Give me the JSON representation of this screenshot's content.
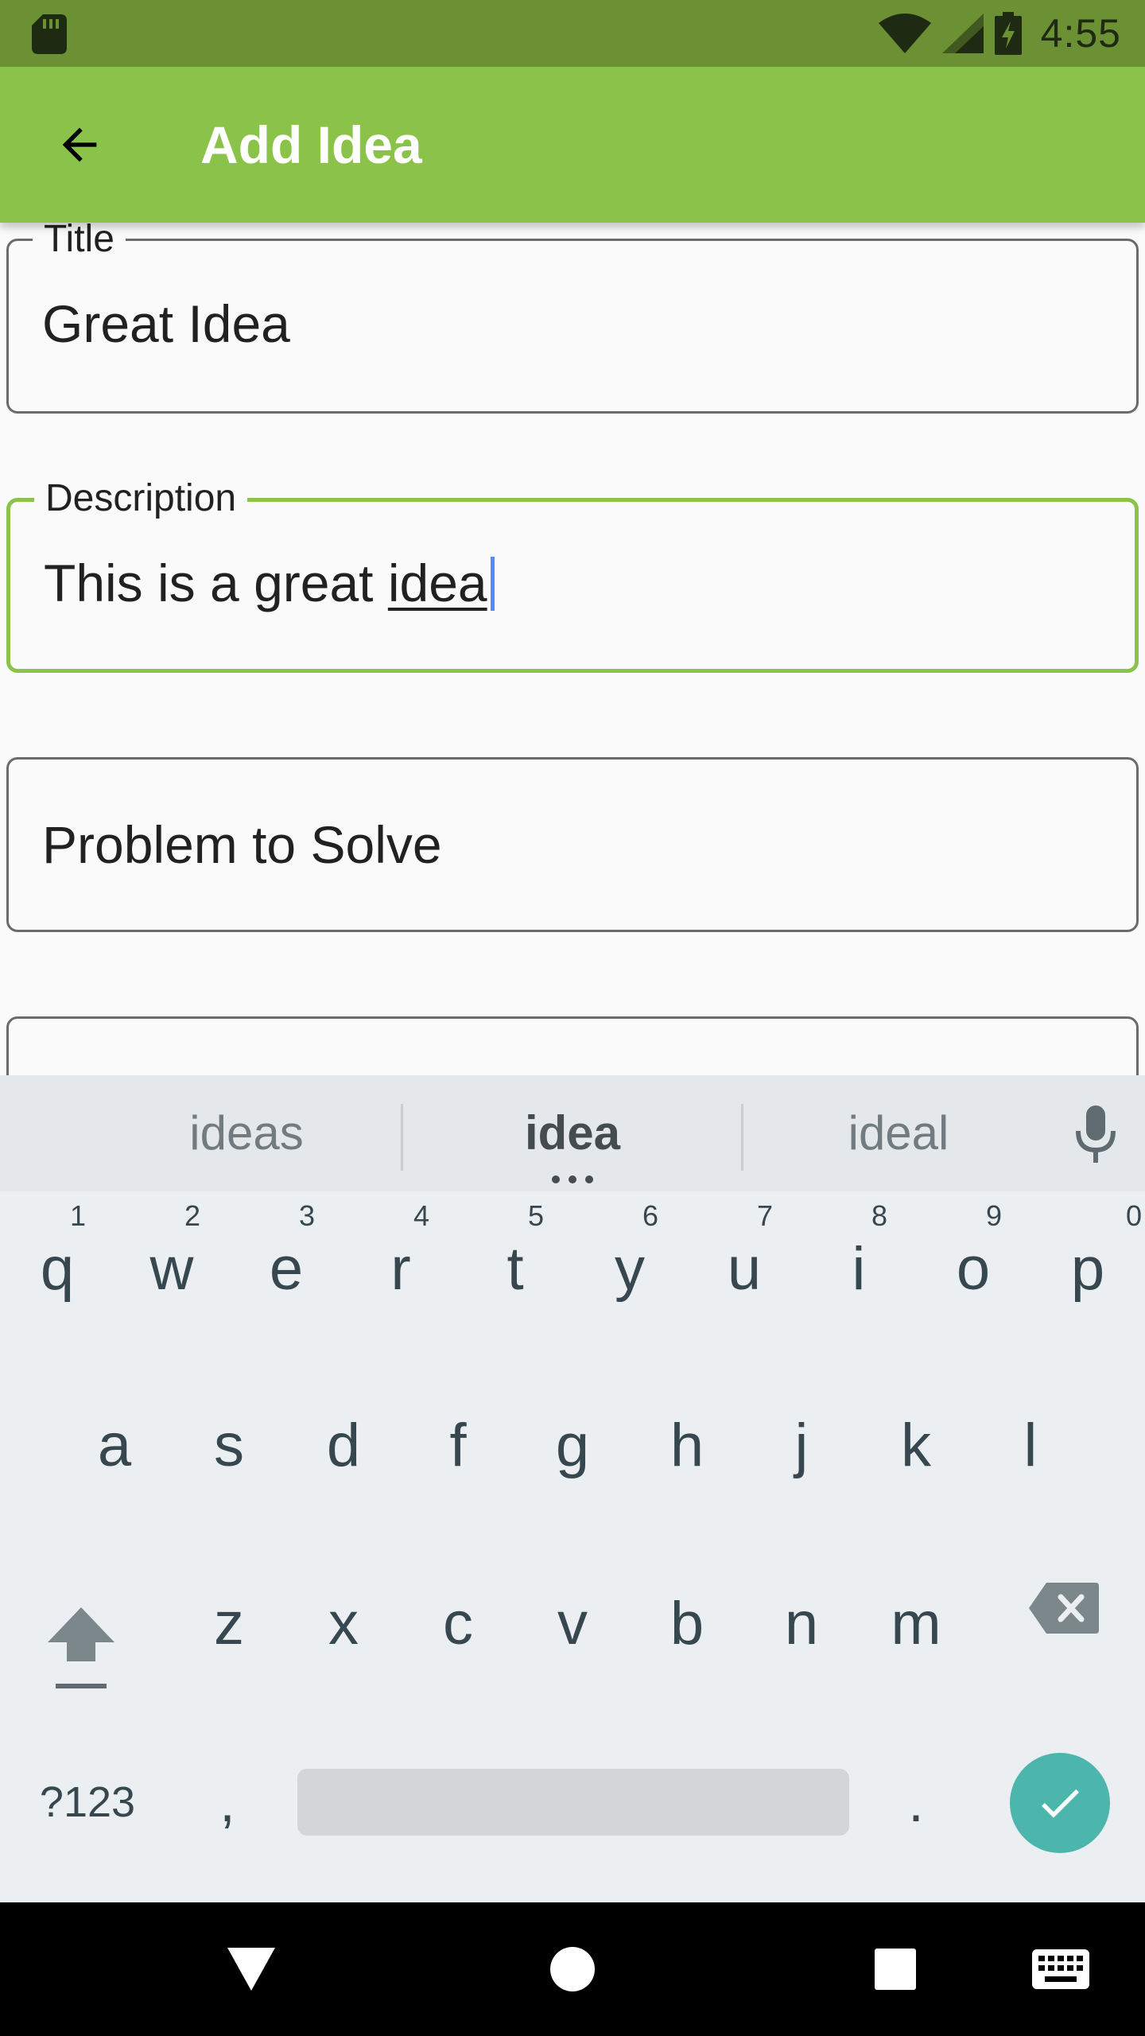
{
  "status_bar": {
    "time": "4:55",
    "icons": [
      "sd-card-icon",
      "wifi-icon",
      "cell-signal-icon",
      "battery-charging-icon"
    ]
  },
  "app_bar": {
    "title": "Add Idea",
    "back_icon": "arrow-back-icon"
  },
  "form": {
    "title_field": {
      "label": "Title",
      "value": "Great Idea"
    },
    "description_field": {
      "label": "Description",
      "value_prefix": "This is a great ",
      "value_composing": "idea"
    },
    "problem_field": {
      "placeholder": "Problem to Solve"
    },
    "accent_color": "#8bc34a"
  },
  "keyboard": {
    "suggestions": [
      "ideas",
      "idea",
      "ideal"
    ],
    "row1": [
      {
        "char": "q",
        "hint": "1"
      },
      {
        "char": "w",
        "hint": "2"
      },
      {
        "char": "e",
        "hint": "3"
      },
      {
        "char": "r",
        "hint": "4"
      },
      {
        "char": "t",
        "hint": "5"
      },
      {
        "char": "y",
        "hint": "6"
      },
      {
        "char": "u",
        "hint": "7"
      },
      {
        "char": "i",
        "hint": "8"
      },
      {
        "char": "o",
        "hint": "9"
      },
      {
        "char": "p",
        "hint": "0"
      }
    ],
    "row2": [
      "a",
      "s",
      "d",
      "f",
      "g",
      "h",
      "j",
      "k",
      "l"
    ],
    "row3": [
      "z",
      "x",
      "c",
      "v",
      "b",
      "n",
      "m"
    ],
    "symbols_label": "?123",
    "comma_label": ",",
    "period_label": ".",
    "enter_color": "#4db6ac"
  },
  "nav_bar": {
    "icons": [
      "back-triangle-icon",
      "home-circle-icon",
      "recents-square-icon",
      "keyboard-switch-icon"
    ]
  }
}
